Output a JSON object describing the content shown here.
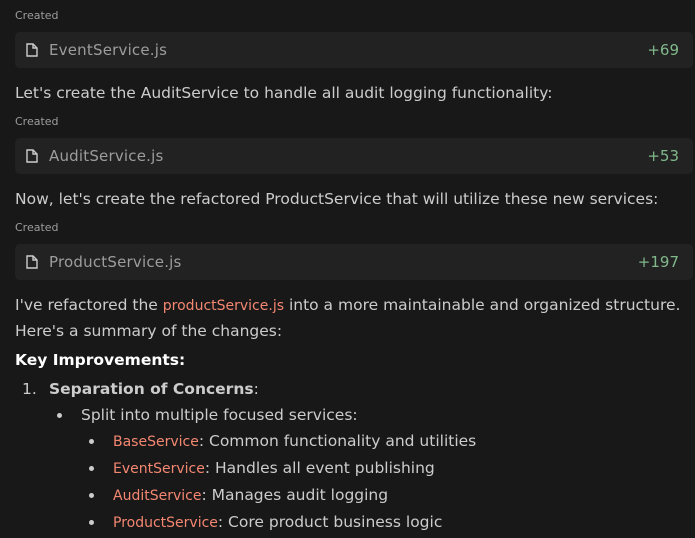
{
  "files": [
    {
      "status": "Created",
      "name": "EventService.js",
      "added": "+69",
      "icon": "file-icon"
    },
    {
      "status": "Created",
      "name": "AuditService.js",
      "added": "+53",
      "icon": "file-icon"
    },
    {
      "status": "Created",
      "name": "ProductService.js",
      "added": "+197",
      "icon": "file-icon"
    }
  ],
  "messages": {
    "audit_intro": "Let's create the AuditService to handle all audit logging functionality:",
    "product_intro": "Now, let's create the refactored ProductService that will utilize these new services:",
    "summary_pre": "I've refactored the ",
    "summary_code": "productService.js",
    "summary_post": " into a more maintainable and organized structure. Here's a summary of the changes:"
  },
  "key_improvements": {
    "heading": "Key Improvements:",
    "items": [
      {
        "number": "1.",
        "title": "Separation of Concerns",
        "suffix": ":",
        "bullet": "Split into multiple focused services:",
        "sub": [
          {
            "code": "BaseService",
            "text": ": Common functionality and utilities"
          },
          {
            "code": "EventService",
            "text": ": Handles all event publishing"
          },
          {
            "code": "AuditService",
            "text": ": Manages audit logging"
          },
          {
            "code": "ProductService",
            "text": ": Core product business logic"
          }
        ]
      }
    ]
  },
  "colors": {
    "background": "#181818",
    "card": "#222222",
    "added": "#81b88b",
    "code": "#f48771"
  }
}
